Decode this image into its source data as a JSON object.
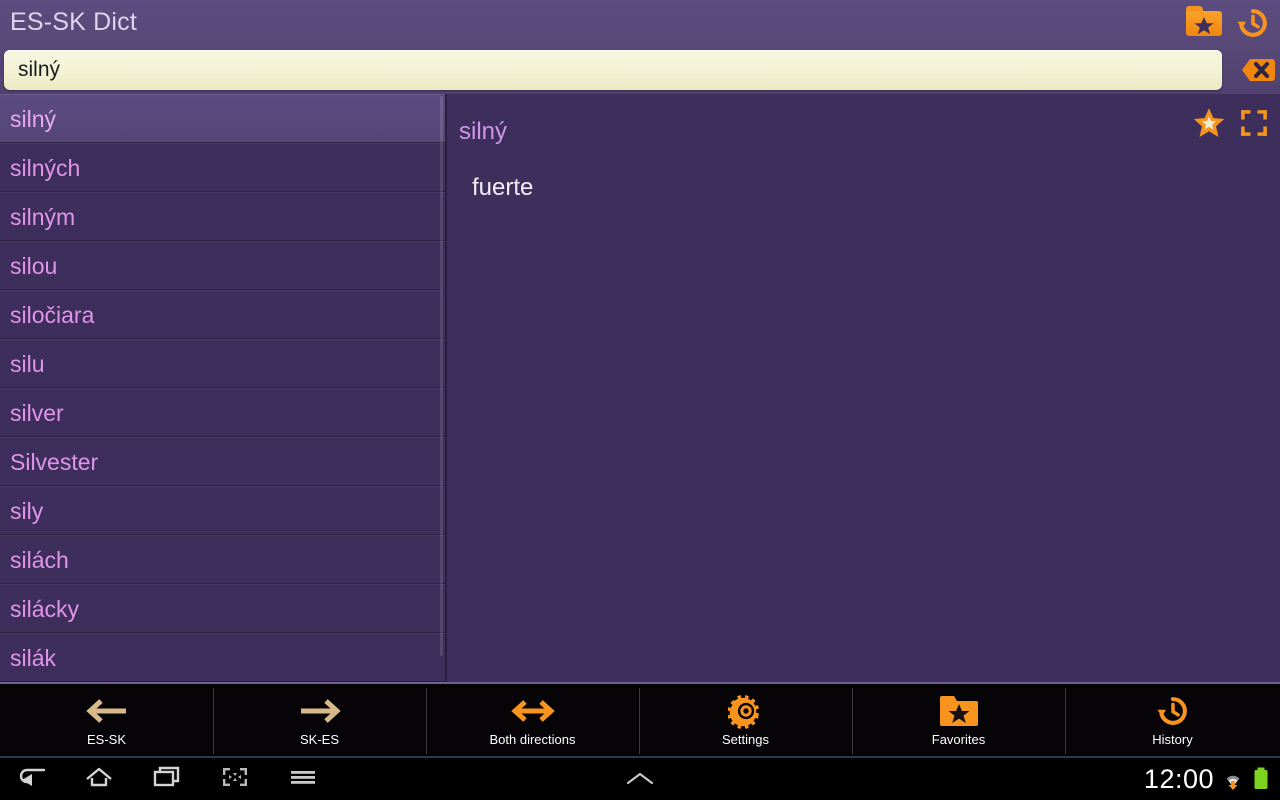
{
  "header": {
    "title": "ES-SK Dict",
    "favorites_icon": "folder-star-icon",
    "history_icon": "history-clock-icon",
    "clear_icon": "clear-backspace-icon"
  },
  "search": {
    "value": "silný",
    "placeholder": "",
    "icon": "search-field"
  },
  "word_list": {
    "selected_index": 0,
    "items": [
      {
        "label": "silný"
      },
      {
        "label": "silných"
      },
      {
        "label": "silným"
      },
      {
        "label": "silou"
      },
      {
        "label": "siločiara"
      },
      {
        "label": "silu"
      },
      {
        "label": "silver"
      },
      {
        "label": "Silvester"
      },
      {
        "label": "sily"
      },
      {
        "label": "silách"
      },
      {
        "label": "silácky"
      },
      {
        "label": "silák"
      }
    ]
  },
  "detail": {
    "headword": "silný",
    "translation": "fuerte",
    "star_icon": "star-icon",
    "expand_icon": "fullscreen-expand-icon"
  },
  "toolbar": {
    "items": [
      {
        "label": "ES-SK",
        "icon": "arrow-left-icon",
        "active": false
      },
      {
        "label": "SK-ES",
        "icon": "arrow-right-icon",
        "active": false
      },
      {
        "label": "Both directions",
        "icon": "arrow-both-icon",
        "active": true
      },
      {
        "label": "Settings",
        "icon": "gear-icon",
        "active": true
      },
      {
        "label": "Favorites",
        "icon": "folder-star-icon",
        "active": true
      },
      {
        "label": "History",
        "icon": "history-clock-icon",
        "active": true
      }
    ]
  },
  "navbar": {
    "back_icon": "back-icon",
    "home_icon": "home-icon",
    "recents_icon": "recent-apps-icon",
    "screenshot_icon": "screenshot-icon",
    "menu_icon": "menu-icon",
    "expand_icon": "chevron-up-icon",
    "clock": "12:00",
    "wifi_icon": "wifi-icon",
    "battery_icon": "battery-icon"
  },
  "colors": {
    "header_purple": "#574776",
    "body_purple": "#3e2e5c",
    "selected_row": "#5b4b80",
    "list_text": "#e095e8",
    "accent_orange": "#f7941e",
    "muted_arrow": "#d8b98a",
    "search_bg": "#f2f2d4",
    "toolbar_bg": "#070408",
    "battery_green": "#7ed321"
  }
}
